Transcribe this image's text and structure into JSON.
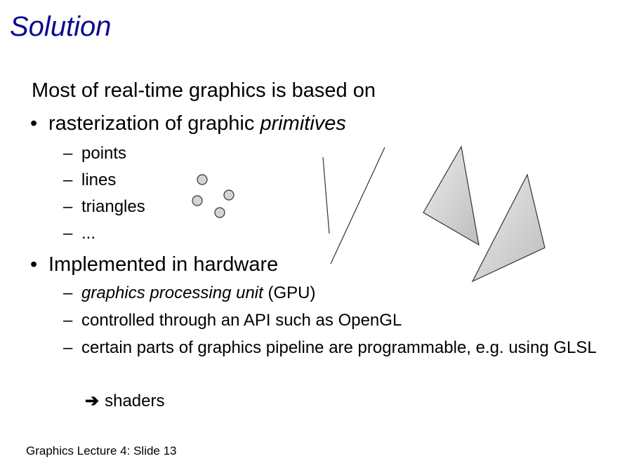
{
  "slide": {
    "title": "Solution",
    "intro": "Most of real-time graphics is based on",
    "bullets": [
      {
        "text_plain": "rasterization of graphic ",
        "text_italic": "primitives",
        "subitems": [
          "points",
          "lines",
          "triangles",
          "..."
        ]
      },
      {
        "text": "Implemented in hardware",
        "subitems": [
          {
            "italic": "graphics processing unit",
            "plain": " (GPU)"
          },
          {
            "plain": "controlled through an API such as OpenGL"
          },
          {
            "plain": "certain parts of graphics pipeline are programmable, e.g. using GLSL"
          }
        ]
      }
    ],
    "conclusion": "shaders",
    "footer": "Graphics Lecture 4: Slide 13"
  },
  "icons": {
    "arrow": "right-arrow-icon",
    "bullet": "bullet-dot",
    "dash": "en-dash"
  },
  "colors": {
    "title": "#0b0b8f",
    "text": "#000000",
    "point_fill": "#d4d4d4",
    "triangle_fill": "#d0d0d0",
    "stroke": "#333333"
  }
}
